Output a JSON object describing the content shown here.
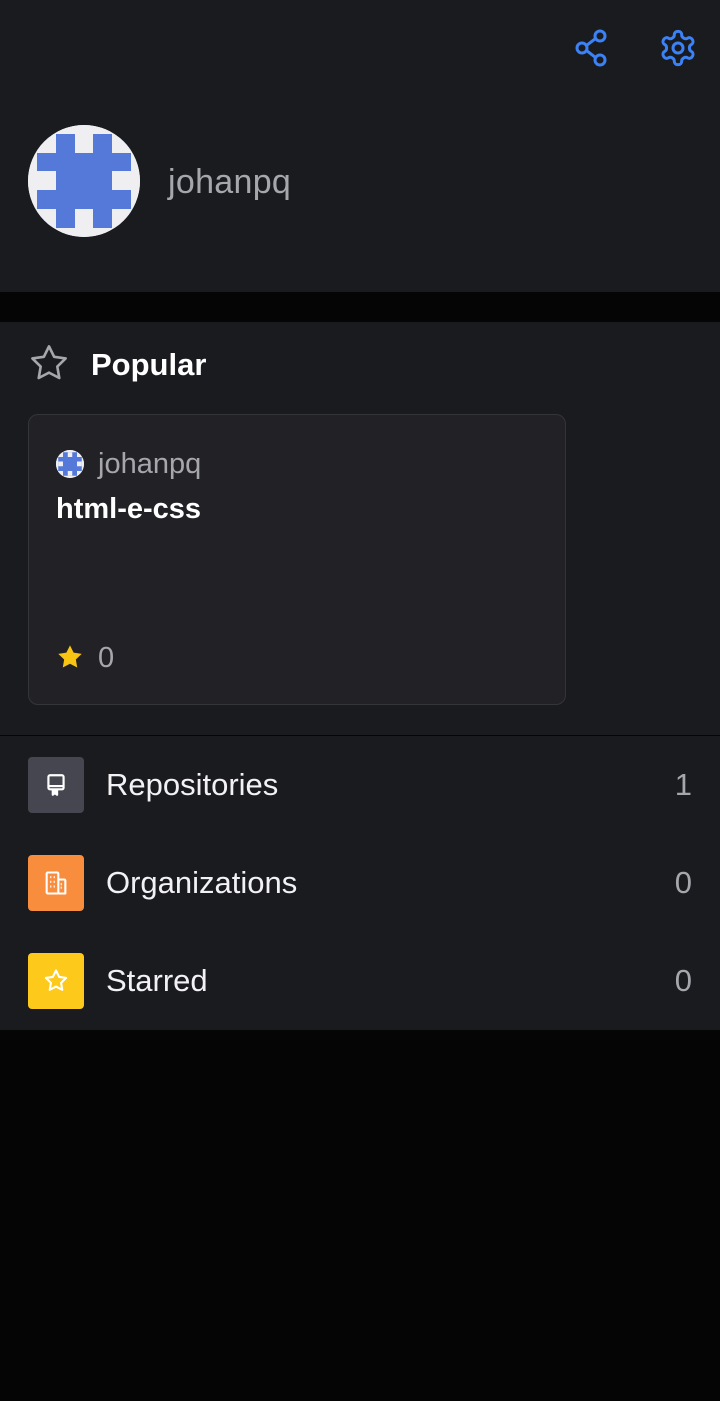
{
  "header": {
    "username": "johanpq",
    "accent_color": "#3b82f6"
  },
  "popular": {
    "title": "Popular",
    "card": {
      "owner": "johanpq",
      "repo_name": "html-e-css",
      "stars": "0",
      "star_color": "#f9c513"
    }
  },
  "menu": {
    "items": [
      {
        "label": "Repositories",
        "count": "1",
        "icon": "repo-icon",
        "color": "#45464f"
      },
      {
        "label": "Organizations",
        "count": "0",
        "icon": "organization-icon",
        "color": "#f98d3e"
      },
      {
        "label": "Starred",
        "count": "0",
        "icon": "star-icon",
        "color": "#fdc91b"
      }
    ]
  }
}
